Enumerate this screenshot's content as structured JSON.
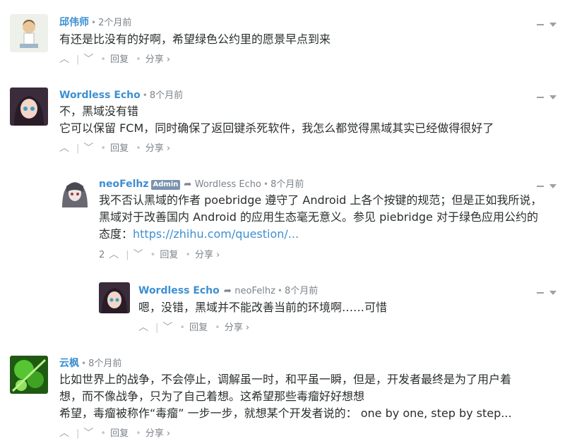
{
  "comments": [
    {
      "author": "邱伟师",
      "time": "2个月前",
      "lines": [
        "有还是比没有的好啊，希望绿色公约里的愿景早点到来"
      ],
      "reply_label": "回复",
      "share_label": "分享 ›"
    },
    {
      "author": "Wordless Echo",
      "time": "8个月前",
      "lines": [
        "不，黑域没有错",
        "它可以保留 FCM，同时确保了返回键杀死软件，我怎么都觉得黑域其实已经做得很好了"
      ],
      "reply_label": "回复",
      "share_label": "分享 ›"
    },
    {
      "author": "neoFelhz",
      "badge": "Admin",
      "reply_to": "Wordless Echo",
      "time": "8个月前",
      "lines": [
        "我不否认黑域的作者 poebridge 遵守了 Android 上各个按键的规范；但是正如我所说，",
        "黑域对于改善国内 Android 的应用生态毫无意义。参见 piebridge 对于绿色应用公约的"
      ],
      "line3_prefix": "态度：",
      "link": "https://zhihu.com/question/...",
      "votes": "2",
      "reply_label": "回复",
      "share_label": "分享 ›"
    },
    {
      "author": "Wordless Echo",
      "reply_to": "neoFelhz",
      "time": "8个月前",
      "lines": [
        "嗯，没错，黑域并不能改善当前的环境啊……可惜"
      ],
      "reply_label": "回复",
      "share_label": "分享 ›"
    },
    {
      "author": "云枫",
      "time": "8个月前",
      "lines": [
        "比如世界上的战争，不会停止，调解虽一时，和平虽一瞬，但是，开发者最终是为了用户着",
        "想，而不像战争，只为了自己着想。这希望那些毒瘤好好想想",
        "希望，毒瘤被称作“毒瘤” 一步一步，就想某个开发者说的： one by one, step by step..."
      ],
      "reply_label": "回复",
      "share_label": "分享 ›"
    }
  ],
  "icons": {
    "upvote": "chevron-up-icon",
    "downvote": "chevron-down-icon",
    "reply_arrow": "reply-arrow-icon",
    "menu_collapse": "collapse-icon",
    "menu_dropdown": "dropdown-icon"
  },
  "colors": {
    "author": "#3d8fd1",
    "meta": "#7c8389",
    "text": "#2a2e2e",
    "badge": "#7b93ad"
  }
}
